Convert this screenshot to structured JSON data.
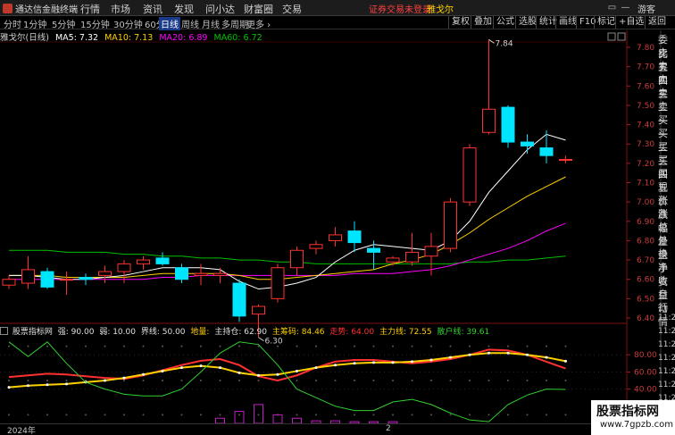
{
  "app": {
    "title": "通达信金融终端",
    "menu": [
      "行情",
      "市场",
      "资讯",
      "发现",
      "问小达",
      "财富圈",
      "交易"
    ],
    "notice_red": "证券交易未登录",
    "notice_yellow": "雅戈尔",
    "guest": "游客",
    "win_controls": [
      "▭",
      "—",
      "❐",
      "✕"
    ]
  },
  "periods": {
    "items": [
      "分时",
      "1分钟",
      "5分钟",
      "15分钟",
      "30分钟",
      "60分钟",
      "日线",
      "周线",
      "月线",
      "多周期",
      "更多 ›"
    ],
    "active": "日线"
  },
  "right_buttons": [
    "复权",
    "叠加",
    "公式",
    "选股",
    "统计",
    "画线",
    "F10",
    "标记",
    "+自选",
    "返回"
  ],
  "stock_title": {
    "name": "雅戈尔(日线)",
    "ma5": "MA5: 7.32",
    "ma10": "MA10: 7.13",
    "ma20": "MA20: 6.89",
    "ma60": "MA60: 6.72"
  },
  "price_axis": [
    "7.80",
    "7.70",
    "7.60",
    "7.50",
    "7.40",
    "7.30",
    "7.20",
    "7.10",
    "7.00",
    "6.90",
    "6.80",
    "6.70",
    "6.60",
    "6.50",
    "6.40"
  ],
  "annotations": {
    "high": "7.84",
    "low": "6.30"
  },
  "indicator_title": {
    "name": "股票指标网",
    "items": [
      {
        "text": "强: 90.00",
        "color": "#e0e0e0"
      },
      {
        "text": "弱: 10.00",
        "color": "#e0e0e0"
      },
      {
        "text": "界线: 50.00",
        "color": "#e0e0e0"
      },
      {
        "text": "地量:",
        "color": "#ffd000"
      },
      {
        "text": "主持仓: 62.90",
        "color": "#e0e0e0"
      },
      {
        "text": "主筹码: 84.46",
        "color": "#ffd000"
      },
      {
        "text": "走势: 64.00",
        "color": "#ff3030"
      },
      {
        "text": "主力线: 72.55",
        "color": "#ffd000"
      },
      {
        "text": "散户线: 39.61",
        "color": "#30d030"
      }
    ]
  },
  "indicator_axis": [
    "80.00",
    "60.00",
    "40.00"
  ],
  "right_panel": [
    "委比",
    "卖五",
    "卖四",
    "卖三",
    "卖二",
    "卖一",
    "买一",
    "买二",
    "买三",
    "买四",
    "买五",
    "现价",
    "涨跌",
    "涨幅",
    "总量",
    "外盘",
    "换手",
    "净资",
    "收益",
    "自动",
    "行情",
    "11:29",
    "11:29",
    "11:29",
    "11:29",
    "11:29",
    "11:29",
    "11:29",
    "11:29",
    "11:29"
  ],
  "footer": {
    "year": "2024年",
    "month": "2"
  },
  "watermark": {
    "title": "股票指标网",
    "url": "www.7gpzb.com"
  },
  "colors": {
    "up": "#ff3232",
    "down": "#00e5ff",
    "ma5": "#ffffff",
    "ma10": "#ffd000",
    "ma20": "#ff00ff",
    "ma60": "#00c000"
  },
  "chart_data": [
    {
      "type": "candlestick",
      "price_range": [
        6.4,
        7.86
      ],
      "candles": [
        {
          "o": 6.57,
          "h": 6.62,
          "l": 6.55,
          "c": 6.6
        },
        {
          "o": 6.58,
          "h": 6.72,
          "l": 6.55,
          "c": 6.65
        },
        {
          "o": 6.64,
          "h": 6.66,
          "l": 6.55,
          "c": 6.56
        },
        {
          "o": 6.6,
          "h": 6.64,
          "l": 6.52,
          "c": 6.6
        },
        {
          "o": 6.61,
          "h": 6.63,
          "l": 6.57,
          "c": 6.6
        },
        {
          "o": 6.62,
          "h": 6.67,
          "l": 6.58,
          "c": 6.64
        },
        {
          "o": 6.64,
          "h": 6.7,
          "l": 6.58,
          "c": 6.68
        },
        {
          "o": 6.68,
          "h": 6.72,
          "l": 6.65,
          "c": 6.7
        },
        {
          "o": 6.71,
          "h": 6.74,
          "l": 6.67,
          "c": 6.68
        },
        {
          "o": 6.66,
          "h": 6.68,
          "l": 6.58,
          "c": 6.6
        },
        {
          "o": 6.62,
          "h": 6.68,
          "l": 6.57,
          "c": 6.63
        },
        {
          "o": 6.62,
          "h": 6.66,
          "l": 6.58,
          "c": 6.63
        },
        {
          "o": 6.58,
          "h": 6.6,
          "l": 6.38,
          "c": 6.41
        },
        {
          "o": 6.42,
          "h": 6.47,
          "l": 6.3,
          "c": 6.46
        },
        {
          "o": 6.5,
          "h": 6.68,
          "l": 6.48,
          "c": 6.66
        },
        {
          "o": 6.66,
          "h": 6.77,
          "l": 6.62,
          "c": 6.75
        },
        {
          "o": 6.76,
          "h": 6.8,
          "l": 6.73,
          "c": 6.78
        },
        {
          "o": 6.8,
          "h": 6.87,
          "l": 6.77,
          "c": 6.83
        },
        {
          "o": 6.85,
          "h": 6.9,
          "l": 6.74,
          "c": 6.79
        },
        {
          "o": 6.76,
          "h": 6.8,
          "l": 6.65,
          "c": 6.74
        },
        {
          "o": 6.69,
          "h": 6.72,
          "l": 6.67,
          "c": 6.71
        },
        {
          "o": 6.69,
          "h": 6.84,
          "l": 6.67,
          "c": 6.74
        },
        {
          "o": 6.72,
          "h": 6.84,
          "l": 6.62,
          "c": 6.77
        },
        {
          "o": 6.76,
          "h": 7.02,
          "l": 6.74,
          "c": 7.0
        },
        {
          "o": 7.0,
          "h": 7.3,
          "l": 6.98,
          "c": 7.28
        },
        {
          "o": 7.36,
          "h": 7.84,
          "l": 7.35,
          "c": 7.48
        },
        {
          "o": 7.49,
          "h": 7.5,
          "l": 7.28,
          "c": 7.31
        },
        {
          "o": 7.31,
          "h": 7.35,
          "l": 7.25,
          "c": 7.29
        },
        {
          "o": 7.28,
          "h": 7.37,
          "l": 7.2,
          "c": 7.24
        },
        {
          "o": 7.22,
          "h": 7.24,
          "l": 7.2,
          "c": 7.22
        }
      ],
      "ma5": [
        6.62,
        6.62,
        6.61,
        6.6,
        6.6,
        6.61,
        6.62,
        6.64,
        6.66,
        6.66,
        6.66,
        6.65,
        6.59,
        6.55,
        6.56,
        6.58,
        6.61,
        6.69,
        6.75,
        6.78,
        6.77,
        6.76,
        6.75,
        6.8,
        6.9,
        7.05,
        7.16,
        7.27,
        7.35,
        7.32
      ],
      "ma10": [
        6.62,
        6.62,
        6.62,
        6.61,
        6.61,
        6.61,
        6.61,
        6.62,
        6.63,
        6.63,
        6.63,
        6.63,
        6.62,
        6.6,
        6.6,
        6.61,
        6.62,
        6.63,
        6.64,
        6.65,
        6.68,
        6.7,
        6.73,
        6.78,
        6.84,
        6.91,
        6.97,
        7.03,
        7.08,
        7.13
      ],
      "ma20": [
        6.6,
        6.6,
        6.6,
        6.6,
        6.6,
        6.6,
        6.6,
        6.6,
        6.61,
        6.61,
        6.62,
        6.62,
        6.62,
        6.62,
        6.62,
        6.62,
        6.62,
        6.62,
        6.63,
        6.63,
        6.63,
        6.64,
        6.65,
        6.67,
        6.7,
        6.73,
        6.76,
        6.8,
        6.85,
        6.89
      ],
      "ma60": [
        6.75,
        6.75,
        6.75,
        6.74,
        6.74,
        6.74,
        6.73,
        6.73,
        6.72,
        6.72,
        6.71,
        6.71,
        6.7,
        6.7,
        6.69,
        6.69,
        6.68,
        6.68,
        6.68,
        6.68,
        6.68,
        6.68,
        6.68,
        6.68,
        6.69,
        6.69,
        6.7,
        6.7,
        6.71,
        6.72
      ]
    },
    {
      "type": "line",
      "range": [
        0,
        100
      ],
      "series": [
        {
          "name": "走势",
          "color": "#ff3030",
          "values": [
            54,
            56,
            58,
            57,
            55,
            53,
            52,
            56,
            62,
            68,
            73,
            75,
            68,
            55,
            50,
            56,
            65,
            72,
            74,
            74,
            72,
            70,
            72,
            75,
            80,
            86,
            85,
            80,
            72,
            64
          ]
        },
        {
          "name": "主力线",
          "color": "#ffd000",
          "values": [
            42,
            44,
            45,
            46,
            48,
            50,
            53,
            57,
            61,
            65,
            67,
            65,
            59,
            56,
            57,
            61,
            65,
            68,
            70,
            71,
            71,
            72,
            74,
            77,
            80,
            82,
            82,
            80,
            77,
            72.55
          ]
        },
        {
          "name": "散户线",
          "color": "#30d030",
          "values": [
            95,
            78,
            95,
            70,
            48,
            40,
            34,
            32,
            32,
            40,
            60,
            82,
            95,
            92,
            68,
            40,
            30,
            20,
            15,
            15,
            25,
            28,
            22,
            12,
            4,
            2,
            22,
            33,
            40,
            39.61
          ]
        }
      ],
      "volume_bars": [
        {
          "i": 11,
          "v": 6
        },
        {
          "i": 12,
          "v": 14
        },
        {
          "i": 13,
          "v": 22
        },
        {
          "i": 14,
          "v": 10
        },
        {
          "i": 15,
          "v": 6
        },
        {
          "i": 16,
          "v": 3
        },
        {
          "i": 17,
          "v": 3
        },
        {
          "i": 18,
          "v": 2
        },
        {
          "i": 19,
          "v": 2
        },
        {
          "i": 20,
          "v": 2
        }
      ]
    }
  ]
}
